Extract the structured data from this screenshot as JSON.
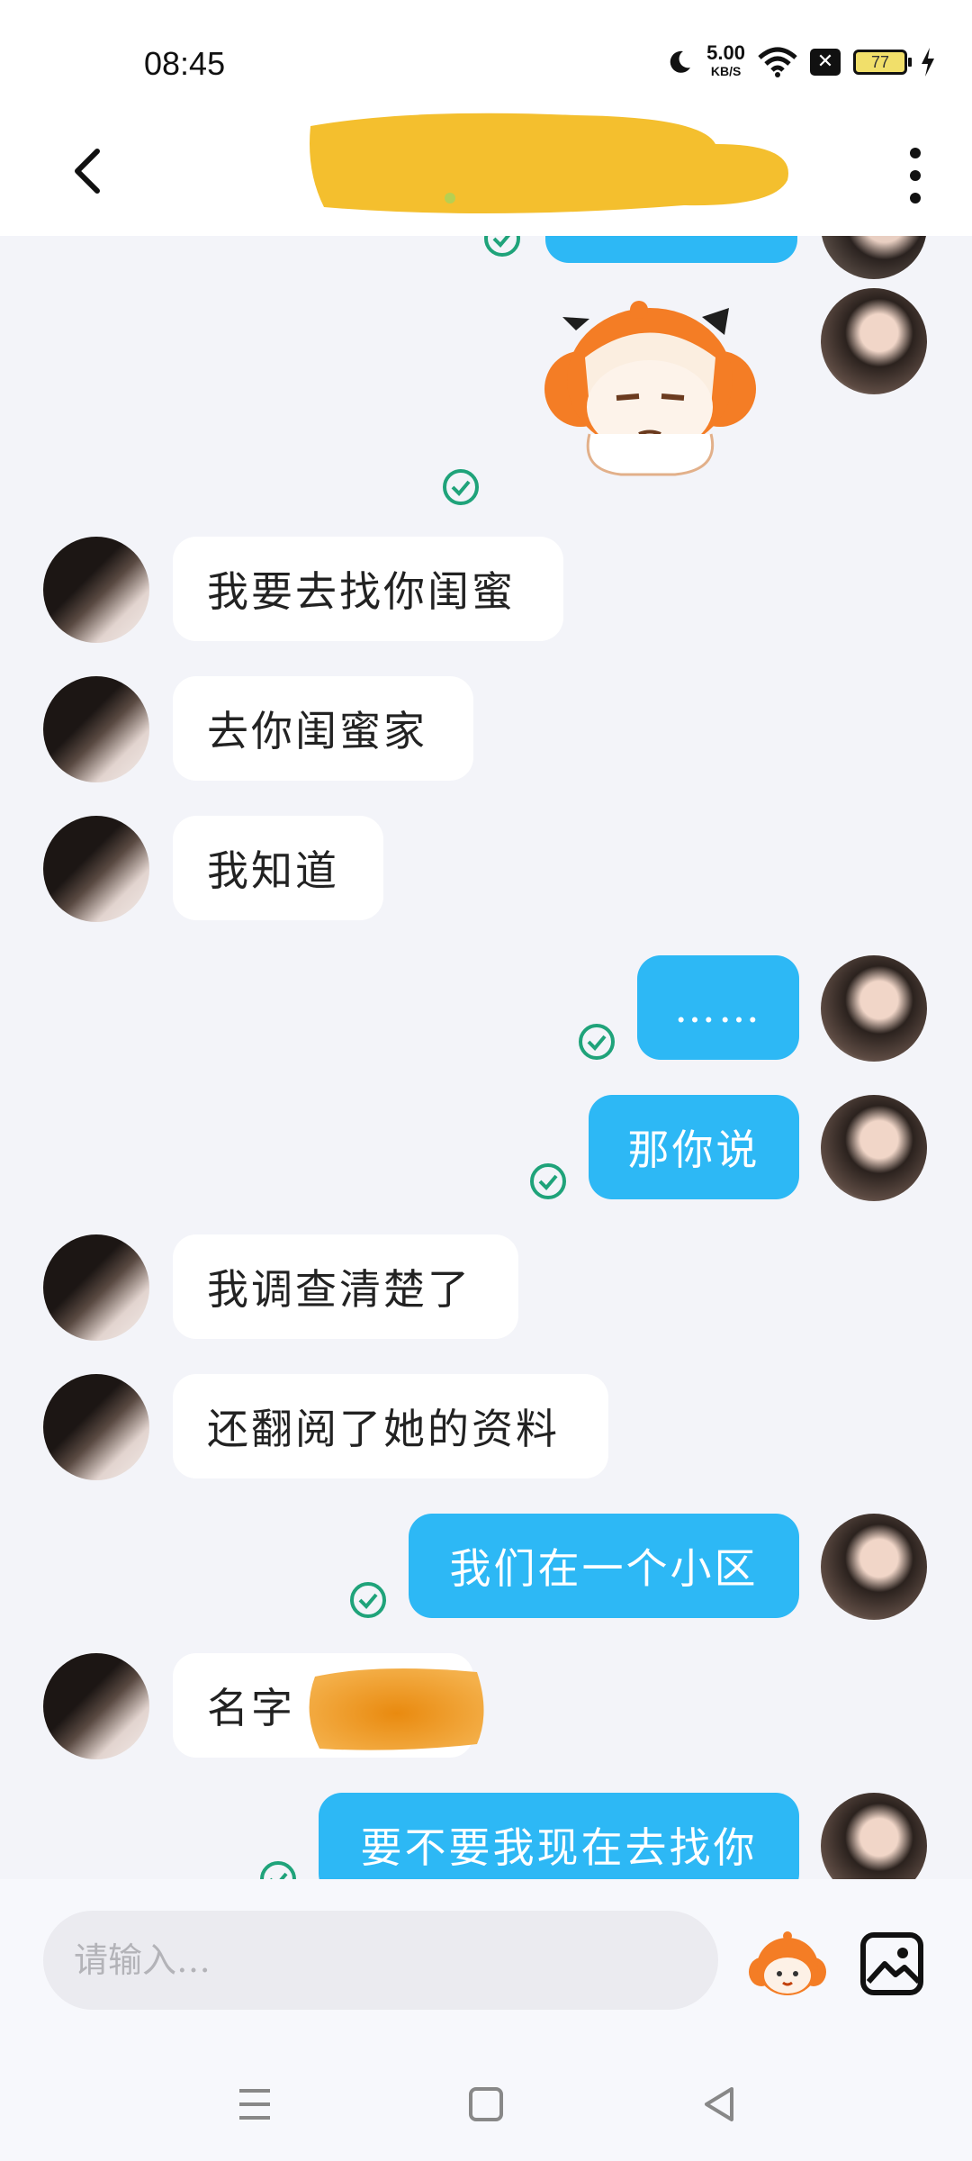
{
  "status_bar": {
    "time": "08:45",
    "net_speed": "5.00",
    "net_unit": "KB/S",
    "battery": "77",
    "icons": [
      "moon-icon",
      "wifi-icon",
      "sim-off-icon",
      "battery-icon",
      "charging-icon"
    ]
  },
  "header": {
    "contact_name": "",
    "back_icon": "chevron-left-icon",
    "more_icon": "more-vertical-icon"
  },
  "messages": [
    {
      "from": "me",
      "type": "sticker",
      "sticker": "orange-haired-cartoon-girl"
    },
    {
      "from": "them",
      "text": "我要去找你闺蜜"
    },
    {
      "from": "them",
      "text": "去你闺蜜家"
    },
    {
      "from": "them",
      "text": "我知道"
    },
    {
      "from": "me",
      "text": "……"
    },
    {
      "from": "me",
      "text": "那你说"
    },
    {
      "from": "them",
      "text": "我调查清楚了"
    },
    {
      "from": "them",
      "text": "还翻阅了她的资料"
    },
    {
      "from": "me",
      "text": "我们在一个小区"
    },
    {
      "from": "them",
      "text": "名字"
    },
    {
      "from": "me",
      "text": "要不要我现在去找你"
    }
  ],
  "input": {
    "placeholder": "请输入…",
    "emoji_icon": "cartoon-emoji-icon",
    "image_icon": "image-icon"
  },
  "nav_bar": [
    "menu-icon",
    "home-square-icon",
    "back-triangle-icon"
  ],
  "colors": {
    "outgoing_bubble": "#2db8f5",
    "incoming_bubble": "#ffffff",
    "read_check": "#1fa37a",
    "background": "#f3f4f9"
  }
}
